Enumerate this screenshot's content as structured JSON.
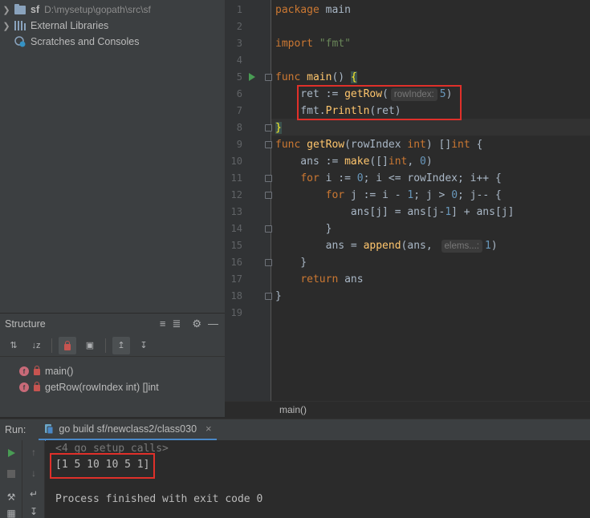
{
  "project_tree": {
    "root": {
      "name": "sf",
      "path": "D:\\mysetup\\gopath\\src\\sf"
    },
    "external_libraries": "External Libraries",
    "scratches": "Scratches and Consoles"
  },
  "structure": {
    "title": "Structure",
    "items": [
      {
        "label": "main()"
      },
      {
        "label": "getRow(rowIndex int) []int"
      }
    ]
  },
  "editor": {
    "line_numbers": [
      "1",
      "2",
      "3",
      "4",
      "5",
      "6",
      "7",
      "8",
      "9",
      "10",
      "11",
      "12",
      "13",
      "14",
      "15",
      "16",
      "17",
      "18",
      "19"
    ],
    "hints": {
      "rowIndex": "rowIndex:",
      "elems": "elems...:"
    },
    "breadcrumb": "main()"
  },
  "run": {
    "label": "Run:",
    "tab_label": "go build sf/newclass2/class030",
    "console": {
      "first_line": "<4 go setup calls>",
      "output": "[1 5 10 10 5 1]",
      "finished": "Process finished with exit code 0"
    }
  },
  "colors": {
    "highlight_box": "#e0302a",
    "keyword": "#cc7832",
    "function": "#ffc66d",
    "number": "#6897bb",
    "string": "#6a8759"
  }
}
